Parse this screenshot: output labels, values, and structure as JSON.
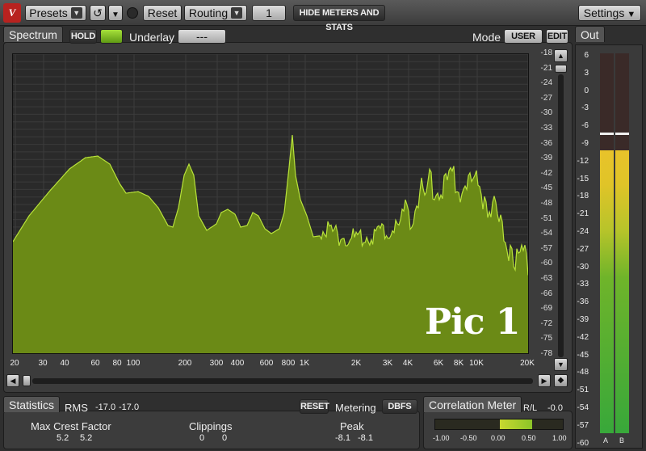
{
  "toolbar": {
    "logo": "V",
    "presets_label": "Presets",
    "reset_label": "Reset",
    "routing_label": "Routing",
    "routing_value": "1",
    "hide_meters_label": "HIDE METERS AND STATS",
    "settings_label": "Settings"
  },
  "spectrum": {
    "tab_label": "Spectrum",
    "hold_label": "HOLD",
    "underlay_label": "Underlay",
    "underlay_value": "---",
    "mode_label": "Mode",
    "mode_user_label": "USER",
    "mode_edit_label": "EDIT",
    "watermark": "Pic 1",
    "db_scale": [
      "-18",
      "-21",
      "-24",
      "-27",
      "-30",
      "-33",
      "-36",
      "-39",
      "-42",
      "-45",
      "-48",
      "-51",
      "-54",
      "-57",
      "-60",
      "-63",
      "-66",
      "-69",
      "-72",
      "-75",
      "-78"
    ],
    "freq_labels": [
      "20",
      "30",
      "40",
      "60",
      "80",
      "100",
      "200",
      "300",
      "400",
      "600",
      "800",
      "1K",
      "2K",
      "3K",
      "4K",
      "6K",
      "8K",
      "10K",
      "20K"
    ],
    "fill_color": "#6b8a16",
    "line_color": "#b8e23a"
  },
  "out": {
    "tab_label": "Out",
    "scale": [
      "6",
      "3",
      "0",
      "-3",
      "-6",
      "-9",
      "-12",
      "-15",
      "-18",
      "-21",
      "-24",
      "-27",
      "-30",
      "-33",
      "-36",
      "-39",
      "-42",
      "-45",
      "-48",
      "-51",
      "-54",
      "-57",
      "-60"
    ],
    "channel_a": "A",
    "channel_b": "B"
  },
  "statistics": {
    "tab_label": "Statistics",
    "rms_label": "RMS",
    "rms_left": "-17.0",
    "rms_right": "-17.0",
    "reset_label": "RESET",
    "metering_label": "Metering",
    "metering_value": "DBFS",
    "max_crest_label": "Max Crest Factor",
    "max_crest_left": "5.2",
    "max_crest_right": "5.2",
    "clippings_label": "Clippings",
    "clippings_left": "0",
    "clippings_right": "0",
    "peak_label": "Peak",
    "peak_left": "-8.1",
    "peak_right": "-8.1"
  },
  "correlation": {
    "tab_label": "Correlation Meter",
    "rl_label": "R/L",
    "rl_value": "-0.0",
    "scale": [
      "-1.00",
      "-0.50",
      "0.00",
      "0.50",
      "1.00"
    ]
  }
}
